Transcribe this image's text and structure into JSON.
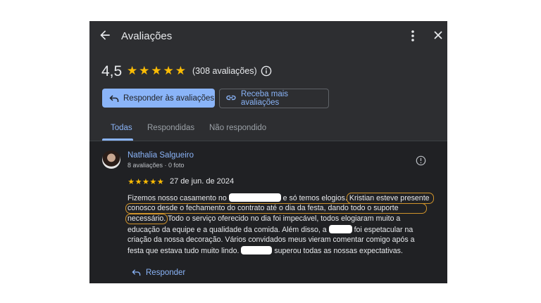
{
  "header": {
    "title": "Avaliações"
  },
  "summary": {
    "rating": "4,5",
    "stars_filled": 5,
    "count_label": "(308 avaliações)"
  },
  "actions": {
    "reply_reviews": "Responder às avaliações",
    "get_more_reviews": "Receba mais avaliações"
  },
  "tabs": [
    {
      "label": "Todas",
      "active": true
    },
    {
      "label": "Respondidas",
      "active": false
    },
    {
      "label": "Não respondido",
      "active": false
    }
  ],
  "review": {
    "author": "Nathalia Salgueiro",
    "meta": "8 avaliações · 0 foto",
    "stars": 5,
    "date": "27 de jun. de 2024",
    "text": {
      "l1a": "Fizemos nosso casamento no",
      "l1b": "e só temos elogios.",
      "l1c": "Kristian esteve presente",
      "l2": "conosco desde o fechamento do contrato até o dia da festa, dando todo o suporte",
      "l3a": "necessário.",
      "l3b": "Todo o serviço oferecido no dia foi impecável, todos elogiaram muito a",
      "l4a": "educação da equipe e a qualidade da comida. Além disso, a",
      "l4b": "foi espetacular na",
      "l5": "criação da nossa decoração. Vários convidados meus vieram comentar comigo após a",
      "l6a": "festa que estava tudo muito lindo.",
      "l6b": "superou todas as nossas expectativas."
    },
    "reply_label": "Responder"
  },
  "colors": {
    "accent": "#8ab4f8",
    "star": "#fbbc04",
    "panel_bg": "#202124",
    "highlight_outline": "#d0942b"
  },
  "icons": [
    "arrow-back-icon",
    "more-vert-icon",
    "close-icon",
    "info-icon",
    "reply-icon",
    "share-icon",
    "star-icon"
  ]
}
